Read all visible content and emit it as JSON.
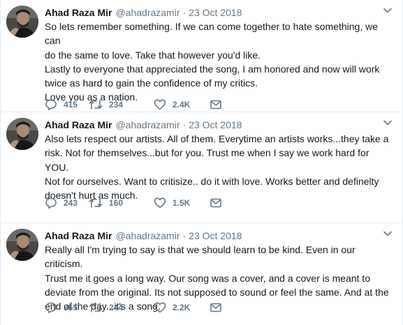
{
  "tweets": [
    {
      "name": "Ahad Raza Mir",
      "handle": "@ahadrazamir",
      "separator": "·",
      "date": "23 Oct 2018",
      "lines": [
        "So lets remember something. If we can come together to hate something, we can",
        "do the same to love. Take that however you'd like.",
        "Lastly to everyone that appreciated the song, I am honored and now will work",
        "twice as hard to gain the confidence of my critics.",
        "Love you as a nation."
      ],
      "replies": "415",
      "retweets": "234",
      "likes": "2.4K"
    },
    {
      "name": "Ahad Raza Mir",
      "handle": "@ahadrazamir",
      "separator": "·",
      "date": "23 Oct 2018",
      "lines": [
        "Also lets respect our artists. All of them. Everytime an artists works...they take a",
        "risk. Not for themselves...but for you. Trust me when I say we work hard for YOU.",
        "Not for ourselves. Want to critisize.. do it with love. Works better and definelty",
        "doesn't hurt as much."
      ],
      "replies": "243",
      "retweets": "160",
      "likes": "1.5K"
    },
    {
      "name": "Ahad Raza Mir",
      "handle": "@ahadrazamir",
      "separator": "·",
      "date": "23 Oct 2018",
      "lines": [
        "Really all I'm trying to say is that we should learn to be kind. Even in our criticism.",
        "Trust me it goes a long way. Our song was a cover, and a cover is meant to",
        "deviate from the original. Its not supposed to sound or feel the same. And at the",
        "end of the day...it's a song."
      ],
      "replies": "365",
      "retweets": "244",
      "likes": "2.2K"
    }
  ],
  "icons": {
    "reply": "reply-icon",
    "retweet": "retweet-icon",
    "like": "heart-icon",
    "message": "envelope-icon",
    "more": "chevron-down-icon",
    "avatar": "profile-photo"
  },
  "colors": {
    "text": "#14171a",
    "secondary": "#657786",
    "divider": "#e6ecf0"
  }
}
